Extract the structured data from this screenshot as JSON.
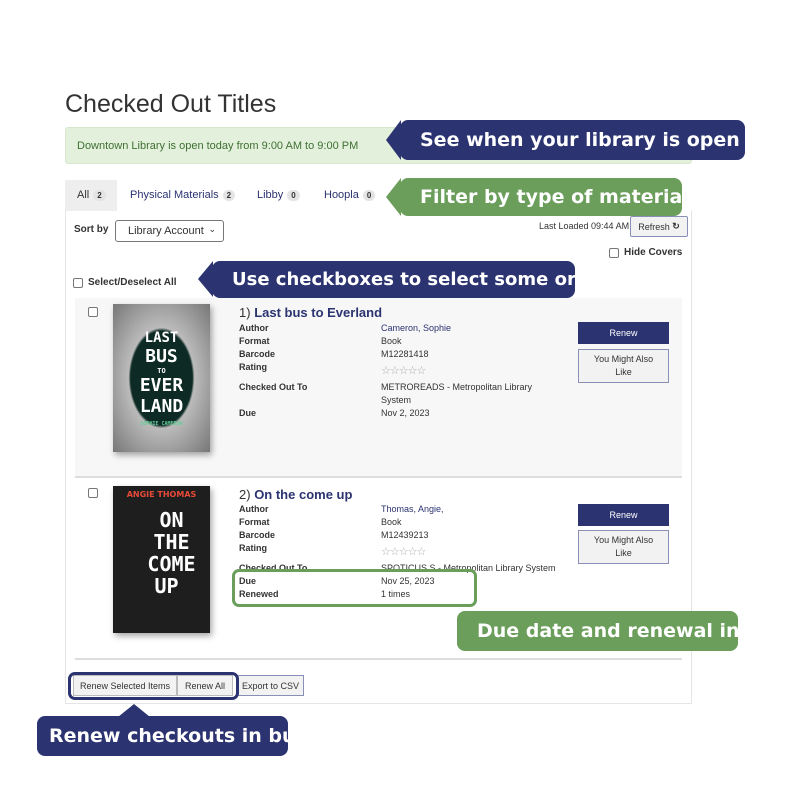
{
  "page_title": "Checked Out Titles",
  "hours_banner": "Downtown Library is open today from 9:00 AM to 9:00 PM",
  "tabs": [
    {
      "label": "All",
      "count": "2"
    },
    {
      "label": "Physical Materials",
      "count": "2"
    },
    {
      "label": "Libby",
      "count": "0"
    },
    {
      "label": "Hoopla",
      "count": "0"
    }
  ],
  "sort": {
    "label": "Sort by",
    "value": "Library Account"
  },
  "last_loaded": "Last Loaded 09:44 AM",
  "refresh_label": "Refresh",
  "hide_covers": "Hide Covers",
  "select_all": "Select/Deselect All",
  "field_labels": {
    "author": "Author",
    "format": "Format",
    "barcode": "Barcode",
    "rating": "Rating",
    "checked_out_to": "Checked Out To",
    "due": "Due",
    "renewed": "Renewed"
  },
  "items": [
    {
      "num": "1)",
      "title": "Last bus to Everland",
      "author": "Cameron, Sophie",
      "format": "Book",
      "barcode": "M12281418",
      "rating": "☆☆☆☆☆",
      "checked_out_to": "METROREADS - Metropolitan Library System",
      "due": "Nov 2, 2023",
      "cover_text": [
        "LAST",
        "BUS",
        "TO",
        "EVER",
        "LAND",
        "SOPHIE CAMERON"
      ]
    },
    {
      "num": "2)",
      "title": "On the come up",
      "author": "Thomas, Angie,",
      "format": "Book",
      "barcode": "M12439213",
      "rating": "☆☆☆☆☆",
      "checked_out_to": "SPOTICUS S - Metropolitan Library System",
      "due": "Nov 25, 2023",
      "renewed": "1 times",
      "cover_text": [
        "ANGIE THOMAS",
        "ON",
        "THE",
        "COME",
        "UP"
      ]
    }
  ],
  "renew_label": "Renew",
  "similar_label": "You Might Also Like",
  "bulk": {
    "renew_selected": "Renew Selected Items",
    "renew_all": "Renew All",
    "export": "Export to CSV"
  },
  "callouts": {
    "hours": "See when your library is open today",
    "filter": "Filter by type of material",
    "checkboxes": "Use checkboxes to select some or all",
    "due": "Due date and renewal info",
    "bulk": "Renew checkouts in bulk"
  },
  "colors": {
    "navy": "#2b3370",
    "green": "#6a9e5a",
    "banner": "#e3f1dc"
  }
}
